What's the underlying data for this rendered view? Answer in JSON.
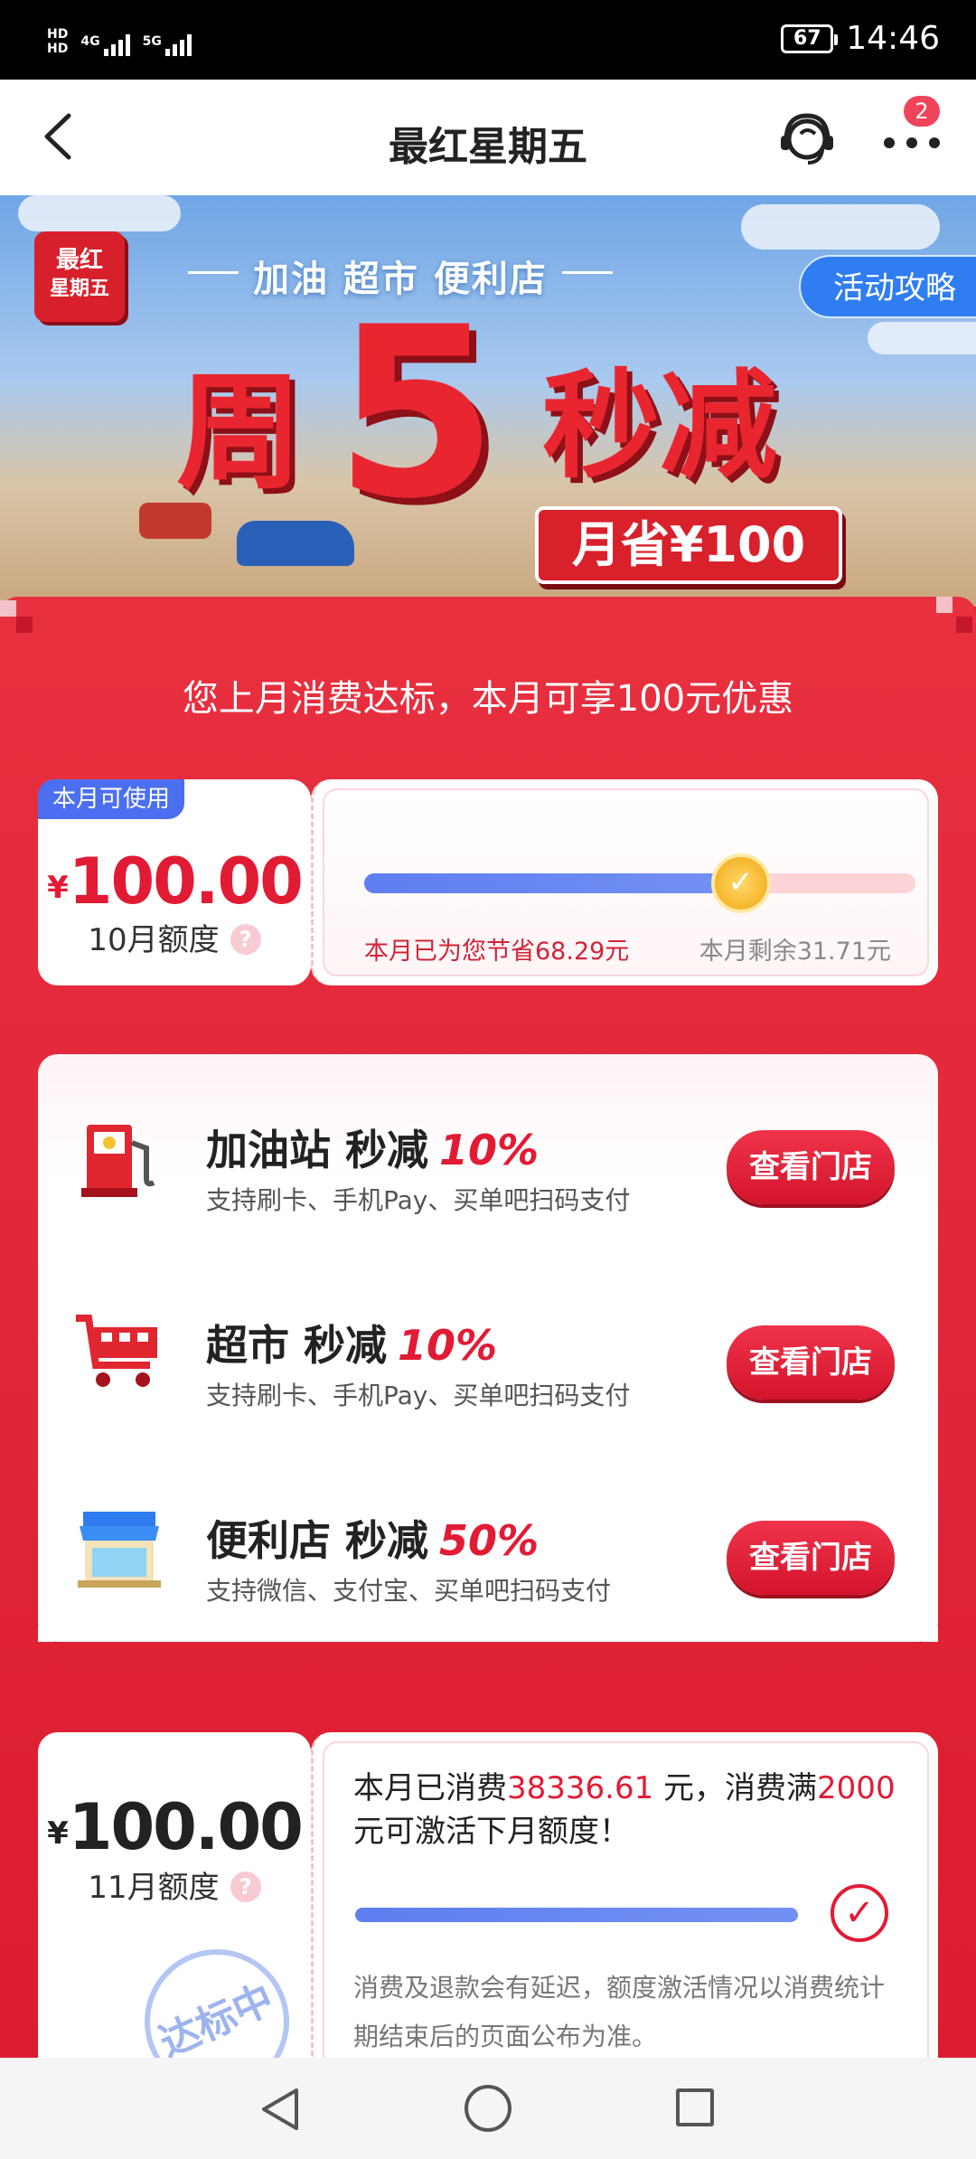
{
  "status_bar": {
    "net_left_1": "HD",
    "net_left_2": "HD",
    "net1": "4G",
    "net2": "5G",
    "battery": "67",
    "time": "14:46"
  },
  "header": {
    "title": "最红星期五",
    "badge_count": "2"
  },
  "banner": {
    "logo_line1": "最红",
    "logo_line2": "星期五",
    "subtitle": "加油 超市 便利店",
    "guide_button": "活动攻略",
    "headline_1": "周",
    "headline_2": "5",
    "headline_3": "秒减",
    "save_plate": "月省¥100"
  },
  "notice": "您上月消费达标，本月可享100元优惠",
  "quota_current": {
    "tag": "本月可使用",
    "currency": "¥",
    "amount": "100.00",
    "label": "10月额度",
    "help": "?",
    "saved_text": "本月已为您节省68.29元",
    "remain_text": "本月剩余31.71元",
    "used_fraction": 0.683,
    "coin_icon": "✓"
  },
  "shops": [
    {
      "icon": "gas-station-icon",
      "name": "加油站 秒减",
      "discount": "10%",
      "desc": "支持刷卡、手机Pay、买单吧扫码支付",
      "button": "查看门店"
    },
    {
      "icon": "shopping-cart-icon",
      "name": "超市 秒减",
      "discount": "10%",
      "desc": "支持刷卡、手机Pay、买单吧扫码支付",
      "button": "查看门店"
    },
    {
      "icon": "convenience-store-icon",
      "name": "便利店 秒减",
      "discount": "50%",
      "desc": "支持微信、支付宝、买单吧扫码支付",
      "button": "查看门店"
    }
  ],
  "quota_next": {
    "currency": "¥",
    "amount": "100.00",
    "label": "11月额度",
    "help": "?",
    "stamp": "达标中",
    "consume_prefix": "本月已消费",
    "consumed": "38336.61",
    "consume_mid": " 元，消费满",
    "threshold": "2000",
    "consume_suffix": " 元可激活下月额度！",
    "progress_fraction": 1.0,
    "check": "✓",
    "disclaimer": "消费及退款会有延迟，额度激活情况以消费统计期结束后的页面公布为准。"
  },
  "colors": {
    "brand_red": "#e21b35",
    "accent_blue": "#5f7ef0",
    "tag_blue": "#4b6ff0"
  }
}
